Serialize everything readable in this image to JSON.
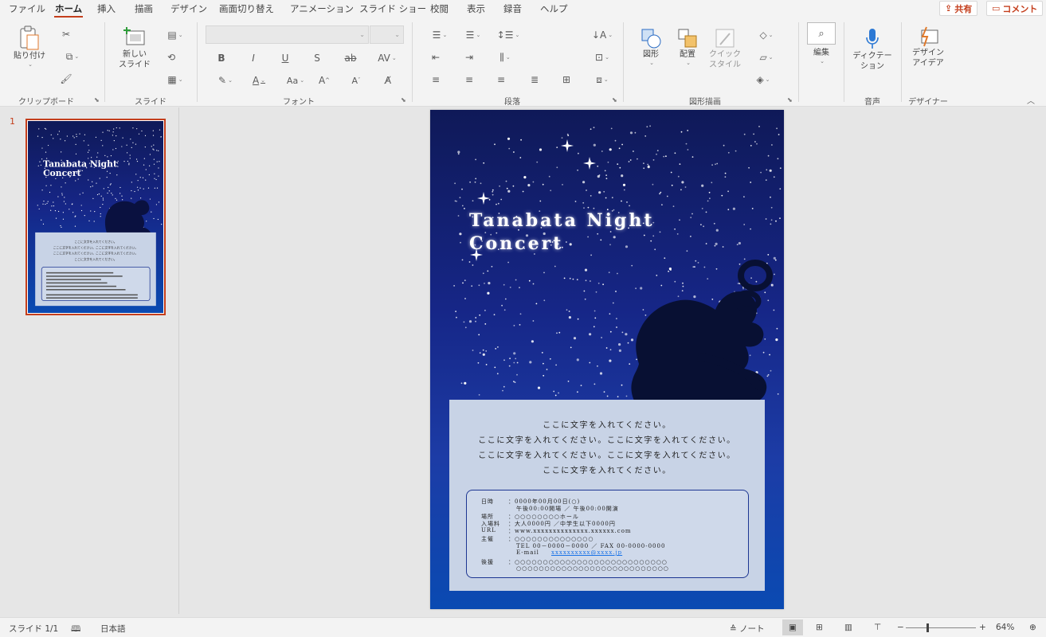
{
  "menu": {
    "tabs": [
      "ファイル",
      "ホーム",
      "挿入",
      "描画",
      "デザイン",
      "画面切り替え",
      "アニメーション",
      "スライド ショー",
      "校閲",
      "表示",
      "録音",
      "ヘルプ"
    ],
    "active": "ホーム",
    "share_label": "共有",
    "comment_label": "コメント"
  },
  "ribbon": {
    "clipboard": {
      "group_label": "クリップボード",
      "paste_label": "貼り付け"
    },
    "slides": {
      "group_label": "スライド",
      "new_slide_label": "新しい\nスライド"
    },
    "font": {
      "group_label": "フォント",
      "font_name": "",
      "font_size": ""
    },
    "paragraph": {
      "group_label": "段落"
    },
    "drawing": {
      "group_label": "図形描画",
      "shape_label": "図形",
      "arrange_label": "配置",
      "quickstyle_label": "クイック\nスタイル"
    },
    "editing": {
      "label": "編集"
    },
    "voice": {
      "group_label": "音声",
      "dictate_label": "ディクテー\nション"
    },
    "designer": {
      "group_label": "デザイナー",
      "ideas_label": "デザイン\nアイデア"
    },
    "accent_color": "#c43e1c"
  },
  "thumbnails": {
    "slide_number": "1"
  },
  "slide": {
    "title_line1": "Tanabata Night",
    "title_line2": "Concert",
    "message_lines": [
      "ここに文字を入れてください。",
      "ここに文字を入れてください。ここに文字を入れてください。",
      "ここに文字を入れてください。ここに文字を入れてください。",
      "ここに文字を入れてください。"
    ],
    "info": {
      "date_label": "日時",
      "date_value": "：0000年00月00日(○)",
      "date_time": "午後00:00開場 ／ 午後00:00開演",
      "venue_label": "場所",
      "venue_value": "：○○○○○○○○ホール",
      "fee_label": "入場料",
      "fee_value": "：大人0000円 ／中学生以下0000円",
      "url_label": "URL",
      "url_value": "：www.xxxxxxxxxxxxxx.xxxxxx.com",
      "host_label": "主催",
      "host_value": "：○○○○○○○○○○○○○○",
      "host_tel": "TEL 00－0000－0000 ／ FAX 00-0000-0000",
      "host_email_label": "E-mail",
      "host_email": "xxxxxxxxxx@xxxx.jp",
      "support_label": "後援",
      "support_value": "：○○○○○○○○○○○○○○○○○○○○○○○○○○○",
      "support_value2": "○○○○○○○○○○○○○○○○○○○○○○○○○○○"
    },
    "colors": {
      "sky_top": "#0f1958",
      "sky_bottom": "#0a4ab2",
      "panel": "#c8d3e6",
      "frame": "#1d3692",
      "link": "#1a73e8"
    }
  },
  "statusbar": {
    "slide_info": "スライド 1/1",
    "language": "日本語",
    "notes_label": "ノート",
    "zoom": "64%"
  }
}
